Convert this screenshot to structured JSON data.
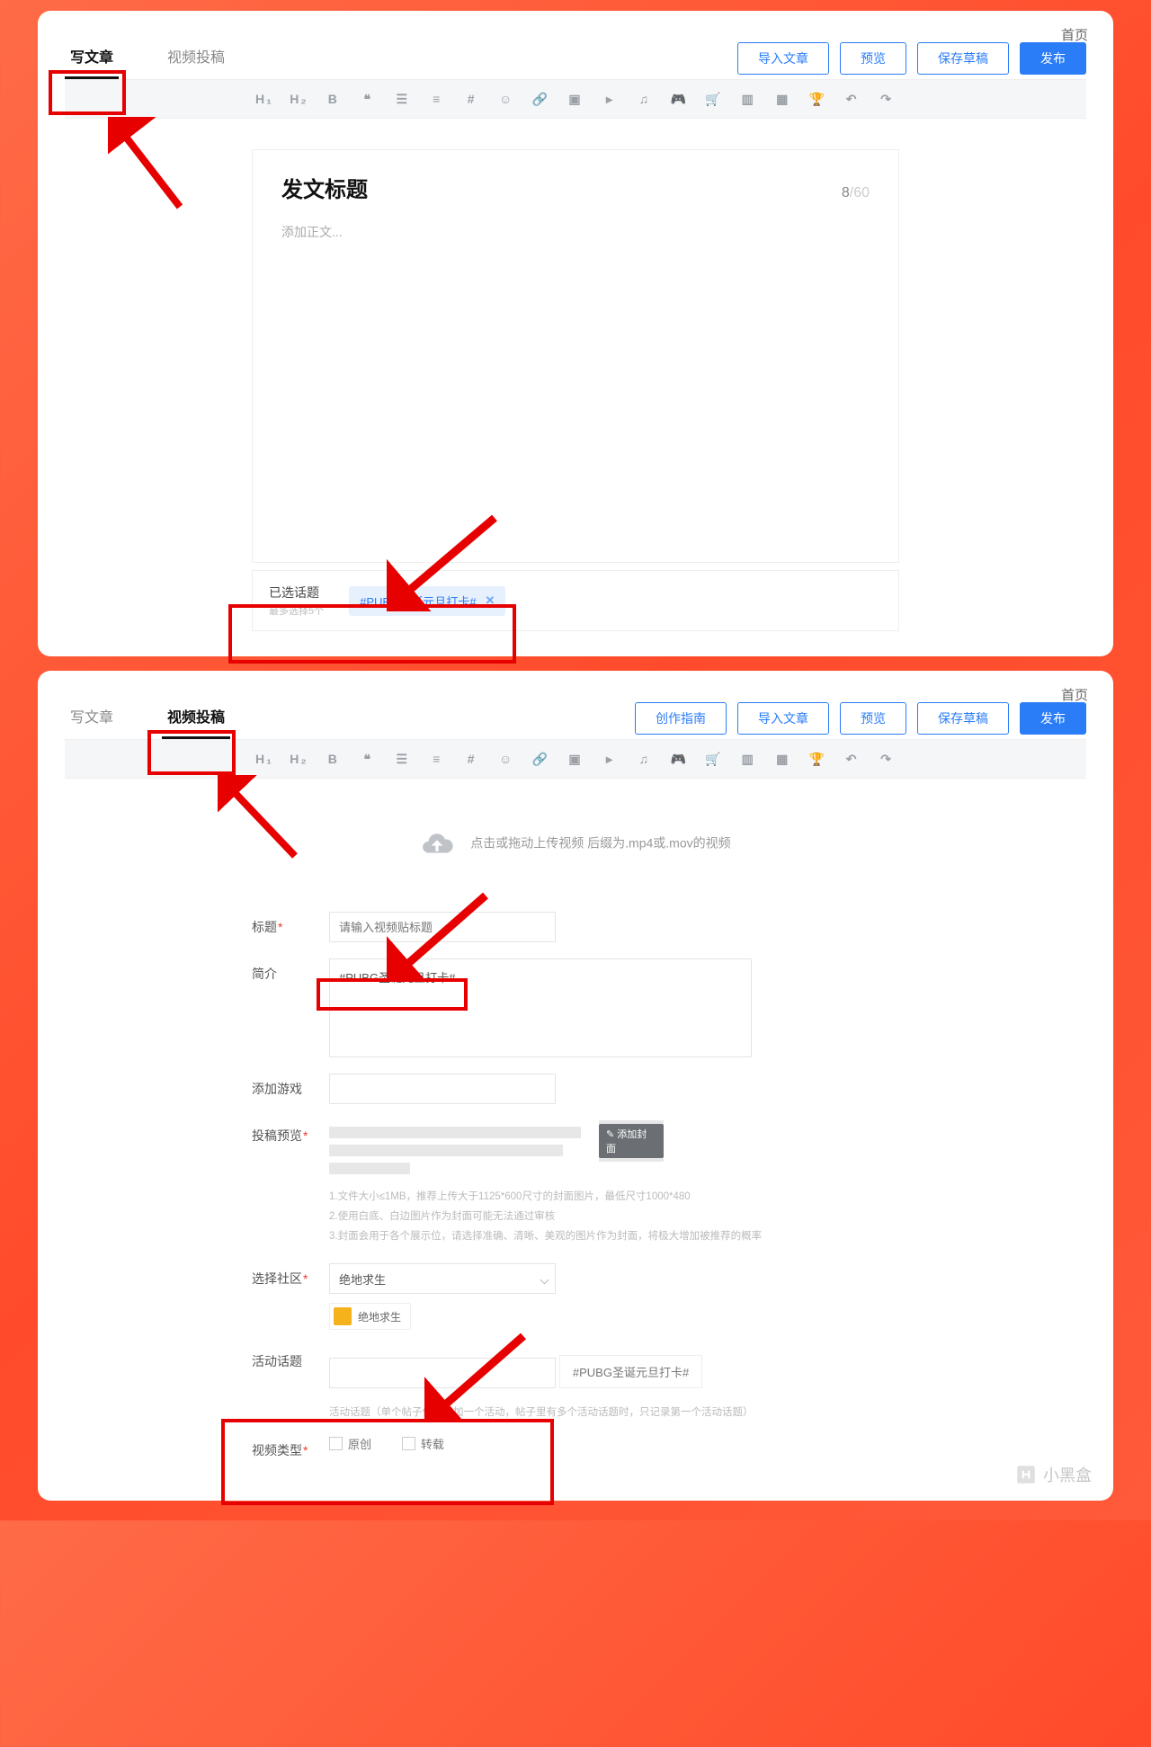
{
  "home": "首页",
  "top": {
    "tabs": {
      "article": "写文章",
      "video": "视频投稿"
    },
    "buttons": {
      "import": "导入文章",
      "preview": "预览",
      "draft": "保存草稿",
      "publish": "发布"
    },
    "title": "发文标题",
    "title_count": "8",
    "title_max": "/60",
    "body_ph": "添加正文...",
    "topic_label": "已选话题",
    "topic_sub": "最多选择5个",
    "topic_tag": "#PUBG圣诞元旦打卡#",
    "topic_x": "✕"
  },
  "bottom": {
    "buttons": {
      "guide": "创作指南",
      "import": "导入文章",
      "preview": "预览",
      "draft": "保存草稿",
      "publish": "发布"
    },
    "upload_text": "点击或拖动上传视频 后缀为.mp4或.mov的视频",
    "form": {
      "title_label": "标题",
      "title_ph": "请输入视频贴标题",
      "intro_label": "简介",
      "intro_tag": "#PUBG圣诞元旦打卡#",
      "game_label": "添加游戏",
      "preview_label": "投稿预览",
      "thumb_btn": "✎ 添加封面",
      "tips1": "1.文件大小≤1MB，推荐上传大于1125*600尺寸的封面图片，最低尺寸1000*480",
      "tips2": "2.使用白底、白边图片作为封面可能无法通过审核",
      "tips3": "3.封面会用于各个展示位，请选择准确、清晰、美观的图片作为封面，将极大增加被推荐的概率",
      "community_label": "选择社区",
      "community_value": "绝地求生",
      "community_chip": "绝地求生",
      "topic_label": "活动话题",
      "topic_chip": "#PUBG圣诞元旦打卡#",
      "topic_hint": "活动话题（单个帖子仅可参加一个活动，帖子里有多个活动话题时，只记录第一个活动话题）",
      "type_label": "视频类型",
      "type_orig": "原创",
      "type_repost": "转载"
    }
  },
  "watermark": "小黑盒"
}
